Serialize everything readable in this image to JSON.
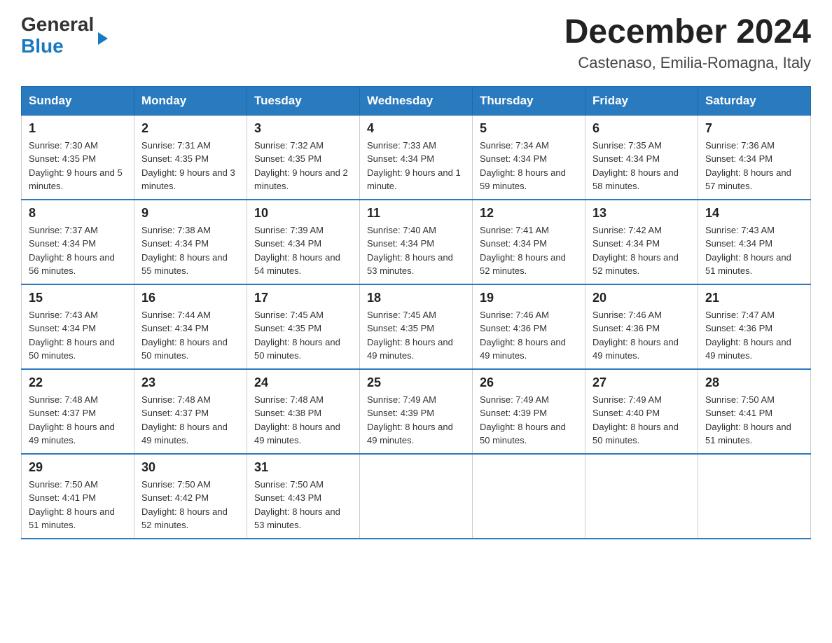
{
  "header": {
    "logo_general": "General",
    "logo_blue": "Blue",
    "title": "December 2024",
    "location": "Castenaso, Emilia-Romagna, Italy"
  },
  "days_of_week": [
    "Sunday",
    "Monday",
    "Tuesday",
    "Wednesday",
    "Thursday",
    "Friday",
    "Saturday"
  ],
  "weeks": [
    [
      {
        "day": "1",
        "sunrise": "7:30 AM",
        "sunset": "4:35 PM",
        "daylight": "9 hours and 5 minutes."
      },
      {
        "day": "2",
        "sunrise": "7:31 AM",
        "sunset": "4:35 PM",
        "daylight": "9 hours and 3 minutes."
      },
      {
        "day": "3",
        "sunrise": "7:32 AM",
        "sunset": "4:35 PM",
        "daylight": "9 hours and 2 minutes."
      },
      {
        "day": "4",
        "sunrise": "7:33 AM",
        "sunset": "4:34 PM",
        "daylight": "9 hours and 1 minute."
      },
      {
        "day": "5",
        "sunrise": "7:34 AM",
        "sunset": "4:34 PM",
        "daylight": "8 hours and 59 minutes."
      },
      {
        "day": "6",
        "sunrise": "7:35 AM",
        "sunset": "4:34 PM",
        "daylight": "8 hours and 58 minutes."
      },
      {
        "day": "7",
        "sunrise": "7:36 AM",
        "sunset": "4:34 PM",
        "daylight": "8 hours and 57 minutes."
      }
    ],
    [
      {
        "day": "8",
        "sunrise": "7:37 AM",
        "sunset": "4:34 PM",
        "daylight": "8 hours and 56 minutes."
      },
      {
        "day": "9",
        "sunrise": "7:38 AM",
        "sunset": "4:34 PM",
        "daylight": "8 hours and 55 minutes."
      },
      {
        "day": "10",
        "sunrise": "7:39 AM",
        "sunset": "4:34 PM",
        "daylight": "8 hours and 54 minutes."
      },
      {
        "day": "11",
        "sunrise": "7:40 AM",
        "sunset": "4:34 PM",
        "daylight": "8 hours and 53 minutes."
      },
      {
        "day": "12",
        "sunrise": "7:41 AM",
        "sunset": "4:34 PM",
        "daylight": "8 hours and 52 minutes."
      },
      {
        "day": "13",
        "sunrise": "7:42 AM",
        "sunset": "4:34 PM",
        "daylight": "8 hours and 52 minutes."
      },
      {
        "day": "14",
        "sunrise": "7:43 AM",
        "sunset": "4:34 PM",
        "daylight": "8 hours and 51 minutes."
      }
    ],
    [
      {
        "day": "15",
        "sunrise": "7:43 AM",
        "sunset": "4:34 PM",
        "daylight": "8 hours and 50 minutes."
      },
      {
        "day": "16",
        "sunrise": "7:44 AM",
        "sunset": "4:34 PM",
        "daylight": "8 hours and 50 minutes."
      },
      {
        "day": "17",
        "sunrise": "7:45 AM",
        "sunset": "4:35 PM",
        "daylight": "8 hours and 50 minutes."
      },
      {
        "day": "18",
        "sunrise": "7:45 AM",
        "sunset": "4:35 PM",
        "daylight": "8 hours and 49 minutes."
      },
      {
        "day": "19",
        "sunrise": "7:46 AM",
        "sunset": "4:36 PM",
        "daylight": "8 hours and 49 minutes."
      },
      {
        "day": "20",
        "sunrise": "7:46 AM",
        "sunset": "4:36 PM",
        "daylight": "8 hours and 49 minutes."
      },
      {
        "day": "21",
        "sunrise": "7:47 AM",
        "sunset": "4:36 PM",
        "daylight": "8 hours and 49 minutes."
      }
    ],
    [
      {
        "day": "22",
        "sunrise": "7:48 AM",
        "sunset": "4:37 PM",
        "daylight": "8 hours and 49 minutes."
      },
      {
        "day": "23",
        "sunrise": "7:48 AM",
        "sunset": "4:37 PM",
        "daylight": "8 hours and 49 minutes."
      },
      {
        "day": "24",
        "sunrise": "7:48 AM",
        "sunset": "4:38 PM",
        "daylight": "8 hours and 49 minutes."
      },
      {
        "day": "25",
        "sunrise": "7:49 AM",
        "sunset": "4:39 PM",
        "daylight": "8 hours and 49 minutes."
      },
      {
        "day": "26",
        "sunrise": "7:49 AM",
        "sunset": "4:39 PM",
        "daylight": "8 hours and 50 minutes."
      },
      {
        "day": "27",
        "sunrise": "7:49 AM",
        "sunset": "4:40 PM",
        "daylight": "8 hours and 50 minutes."
      },
      {
        "day": "28",
        "sunrise": "7:50 AM",
        "sunset": "4:41 PM",
        "daylight": "8 hours and 51 minutes."
      }
    ],
    [
      {
        "day": "29",
        "sunrise": "7:50 AM",
        "sunset": "4:41 PM",
        "daylight": "8 hours and 51 minutes."
      },
      {
        "day": "30",
        "sunrise": "7:50 AM",
        "sunset": "4:42 PM",
        "daylight": "8 hours and 52 minutes."
      },
      {
        "day": "31",
        "sunrise": "7:50 AM",
        "sunset": "4:43 PM",
        "daylight": "8 hours and 53 minutes."
      },
      null,
      null,
      null,
      null
    ]
  ]
}
